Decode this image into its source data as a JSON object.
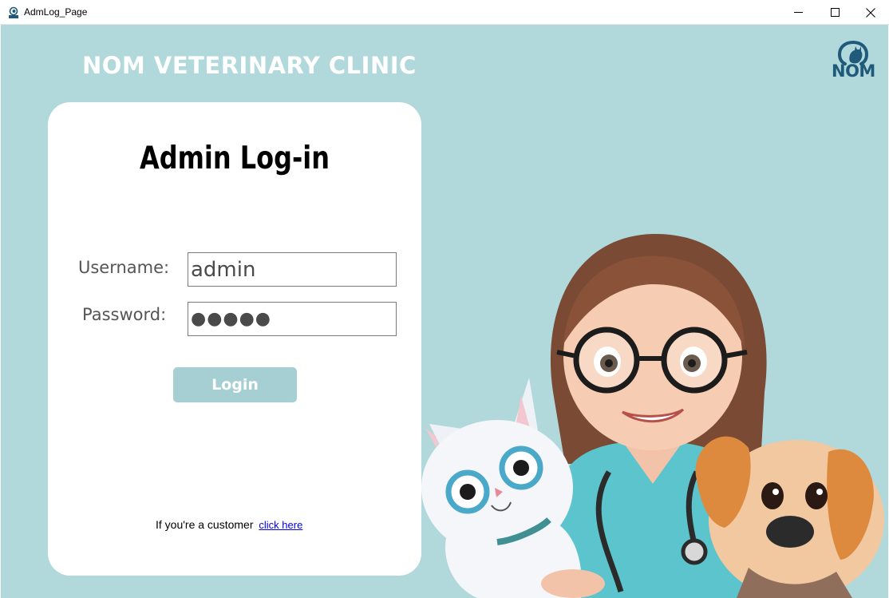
{
  "window": {
    "title": "AdmLog_Page",
    "controls": [
      "minimize-icon",
      "maximize-icon",
      "close-icon"
    ]
  },
  "header": {
    "clinic_name": "NOM VETERINARY CLINIC",
    "logo_text": "NOM"
  },
  "login": {
    "heading": "Admin Log-in",
    "username_label": "Username:",
    "username_value": "admin",
    "password_label": "Password:",
    "password_value": "●●●●●",
    "login_button": "Login"
  },
  "footer": {
    "customer_text": "If you're a customer",
    "customer_link": "click here"
  },
  "colors": {
    "background": "#b1d8db",
    "card": "#ffffff",
    "button": "#a6cfd3",
    "logo": "#1f5a7a",
    "link": "#0000ee"
  }
}
